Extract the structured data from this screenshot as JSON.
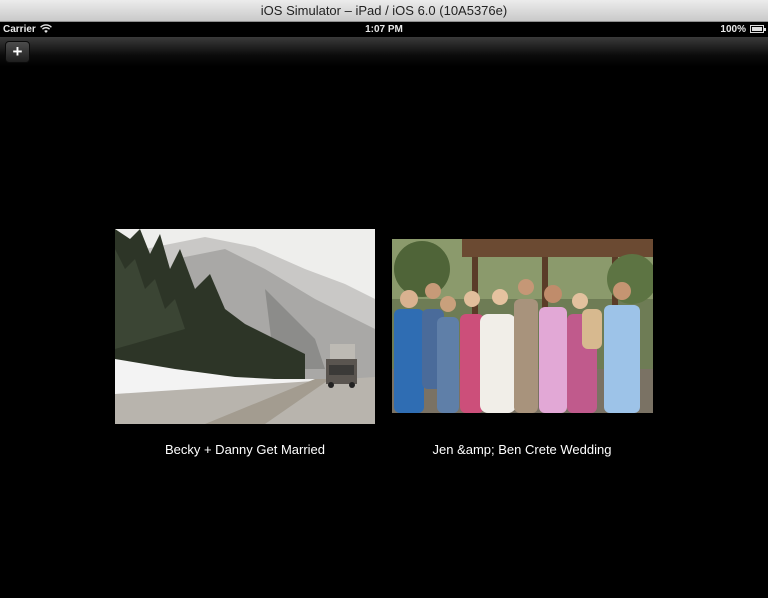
{
  "window": {
    "title": "iOS Simulator – iPad / iOS 6.0 (10A5376e)"
  },
  "status_bar": {
    "carrier": "Carrier",
    "time": "1:07 PM",
    "battery": "100%"
  },
  "nav": {
    "add_label": "+"
  },
  "albums": [
    {
      "caption": "Becky + Danny Get Married",
      "thumbnail": "snowy-mountain-highway-photo"
    },
    {
      "caption": "Jen &amp; Ben Crete Wedding",
      "thumbnail": "wedding-group-photo"
    }
  ]
}
